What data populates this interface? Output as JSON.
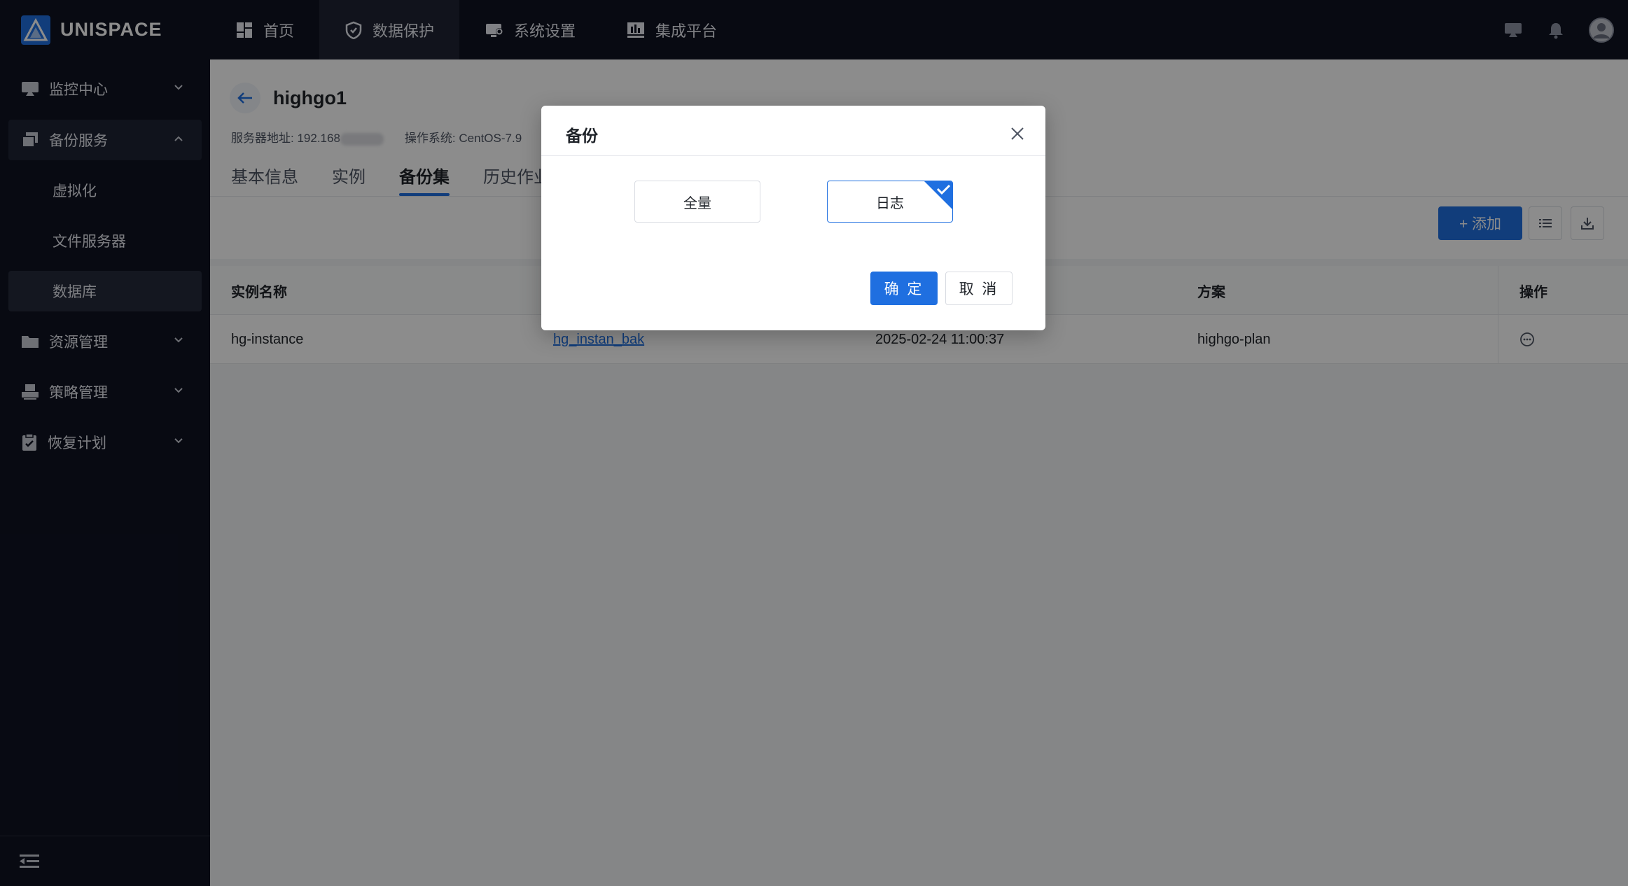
{
  "app": {
    "logo_text": "UNISPACE",
    "accent": "#1f6fe0"
  },
  "topnav": [
    {
      "label": "首页",
      "icon": "dashboard-icon",
      "active": false
    },
    {
      "label": "数据保护",
      "icon": "shield-icon",
      "active": true
    },
    {
      "label": "系统设置",
      "icon": "monitor-gear-icon",
      "active": false
    },
    {
      "label": "集成平台",
      "icon": "bar-chart-icon",
      "active": false
    }
  ],
  "top_right_icons": [
    "screen-icon",
    "bell-icon",
    "user-avatar-icon"
  ],
  "sidebar": {
    "items": [
      {
        "label": "监控中心",
        "icon": "monitor-icon",
        "expanded": false
      },
      {
        "label": "备份服务",
        "icon": "copy-icon",
        "expanded": true
      },
      {
        "label": "资源管理",
        "icon": "folder-icon",
        "expanded": false
      },
      {
        "label": "策略管理",
        "icon": "printer-icon",
        "expanded": false
      },
      {
        "label": "恢复计划",
        "icon": "clipboard-check-icon",
        "expanded": false
      }
    ],
    "sub_items": [
      {
        "label": "虚拟化",
        "active": false
      },
      {
        "label": "文件服务器",
        "active": false
      },
      {
        "label": "数据库",
        "active": true
      }
    ],
    "collapse_icon": "collapse-menu-icon"
  },
  "page": {
    "title": "highgo1",
    "server_label": "服务器地址:",
    "server_value": "192.168",
    "os_label": "操作系统:",
    "os_value": "CentOS-7.9",
    "tabs": [
      "基本信息",
      "实例",
      "备份集",
      "历史作业"
    ],
    "active_tab": "备份集",
    "add_button": "+ 添加"
  },
  "table": {
    "columns": [
      "实例名称",
      "",
      "",
      "方案",
      "操作"
    ],
    "rows": [
      {
        "instance": "hg-instance",
        "backup_set": "hg_instan_bak",
        "time": "2025-02-24 11:00:37",
        "plan": "highgo-plan",
        "action_icon": "more-icon"
      }
    ]
  },
  "modal": {
    "title": "备份",
    "options": [
      {
        "label": "全量",
        "selected": false
      },
      {
        "label": "日志",
        "selected": true
      }
    ],
    "ok_label": "确 定",
    "cancel_label": "取 消"
  }
}
